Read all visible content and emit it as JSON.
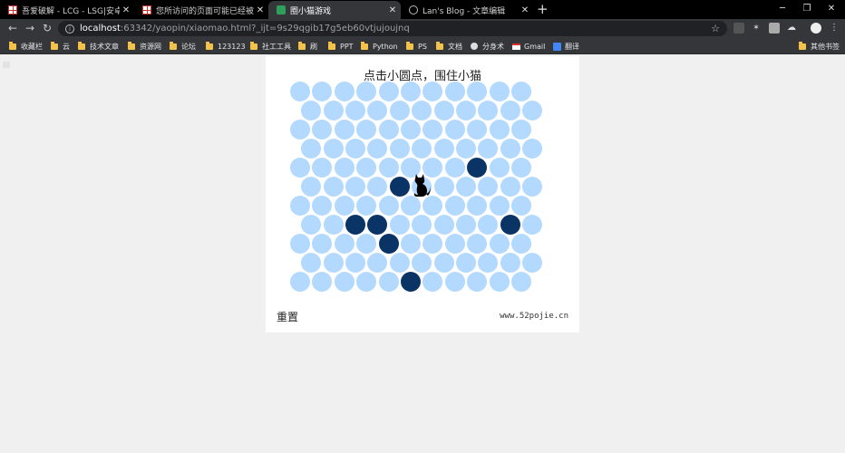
{
  "tabs": [
    {
      "title": "吾爱破解 - LCG - LSG|安卓破解",
      "icon": "red-grid-icon",
      "active": false
    },
    {
      "title": "您所访问的页面可能已经被删除",
      "icon": "red-grid-icon",
      "active": false
    },
    {
      "title": "圈小猫游戏",
      "icon": "game-icon",
      "active": true
    },
    {
      "title": "Lan's Blog - 文章编辑",
      "icon": "globe-icon",
      "active": false
    }
  ],
  "toolbar": {
    "url_host": "localhost",
    "url_rest": ":63342/yaopin/xiaomao.html?_ijt=9s29qgib17g5eb60vtjujoujnq"
  },
  "bookmarks": [
    {
      "label": "收藏栏",
      "icon": "folder-icon"
    },
    {
      "label": "云",
      "icon": "folder-icon"
    },
    {
      "label": "技术文章",
      "icon": "folder-icon"
    },
    {
      "label": "资源网",
      "icon": "folder-icon"
    },
    {
      "label": "论坛",
      "icon": "folder-icon"
    },
    {
      "label": "123123",
      "icon": "folder-icon"
    },
    {
      "label": "社工工具",
      "icon": "folder-icon"
    },
    {
      "label": "刷",
      "icon": "folder-icon"
    },
    {
      "label": "PPT",
      "icon": "folder-icon"
    },
    {
      "label": "Python",
      "icon": "folder-icon"
    },
    {
      "label": "PS",
      "icon": "folder-icon"
    },
    {
      "label": "文档",
      "icon": "folder-icon"
    },
    {
      "label": "分身术",
      "icon": "globe-icon"
    },
    {
      "label": "Gmail",
      "icon": "gmail-icon"
    },
    {
      "label": "翻译",
      "icon": "translate-icon"
    }
  ],
  "other_bookmarks": "其他书签",
  "game": {
    "title": "点击小圆点，围住小猫",
    "reset_label": "重置",
    "site_label": "www.52pojie.cn",
    "rows": 11,
    "cols": 11,
    "blocked": [
      [
        4,
        8
      ],
      [
        5,
        4
      ],
      [
        7,
        2
      ],
      [
        7,
        3
      ],
      [
        7,
        9
      ],
      [
        8,
        4
      ],
      [
        10,
        5
      ]
    ],
    "cat_position": [
      5,
      5
    ],
    "colors": {
      "empty": "#b3d9ff",
      "blocked": "#0b3466",
      "cat": "#000000"
    }
  }
}
